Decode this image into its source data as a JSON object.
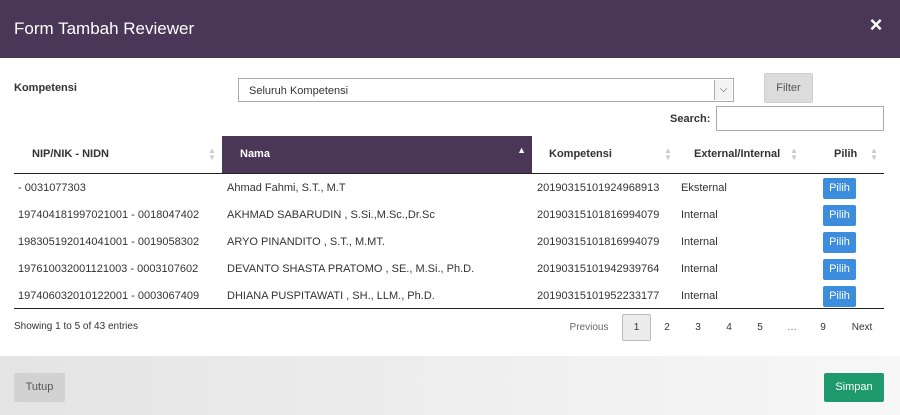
{
  "modal": {
    "title": "Form Tambah Reviewer",
    "close_icon": "×"
  },
  "filter": {
    "label": "Kompetensi",
    "selected": "Seluruh Kompetensi",
    "button_label": "Filter"
  },
  "search": {
    "label": "Search:",
    "value": ""
  },
  "table": {
    "columns": [
      "NIP/NIK - NIDN",
      "Nama",
      "Kompetensi",
      "External/Internal",
      "Pilih"
    ],
    "sorted_column": "Nama",
    "rows": [
      {
        "nip": "- 0031077303",
        "nama": "Ahmad Fahmi, S.T., M.T",
        "kompetensi": "2019031510192496891​3",
        "type": "Eksternal",
        "action": "Pilih"
      },
      {
        "nip": "197404181997021001 - 0018047402",
        "nama": "AKHMAD SABARUDIN , S.Si.,M.Sc.,Dr.Sc",
        "kompetensi": "20190315101816994079",
        "type": "Internal",
        "action": "Pilih"
      },
      {
        "nip": "198305192014041001 - 0019058302",
        "nama": "ARYO PINANDITO , S.T., M.MT.",
        "kompetensi": "20190315101816994079",
        "type": "Internal",
        "action": "Pilih"
      },
      {
        "nip": "197610032001121003 - 0003107602",
        "nama": "DEVANTO SHASTA PRATOMO , SE., M.Si., Ph.D.",
        "kompetensi": "20190315101942939764",
        "type": "Internal",
        "action": "Pilih"
      },
      {
        "nip": "197406032010122001 - 0003067409",
        "nama": "DHIANA PUSPITAWATI , SH., LLM., Ph.D.",
        "kompetensi": "20190315101952233177",
        "type": "Internal",
        "action": "Pilih"
      }
    ]
  },
  "pagination": {
    "info": "Showing 1 to 5 of 43 entries",
    "previous": "Previous",
    "pages": [
      "1",
      "2",
      "3",
      "4",
      "5",
      "…",
      "9"
    ],
    "current": "1",
    "next": "Next"
  },
  "footer": {
    "close_label": "Tutup",
    "save_label": "Simpan"
  },
  "colors": {
    "header": "#4a3656",
    "primary": "#3c8dde",
    "success": "#1e9a6e"
  }
}
